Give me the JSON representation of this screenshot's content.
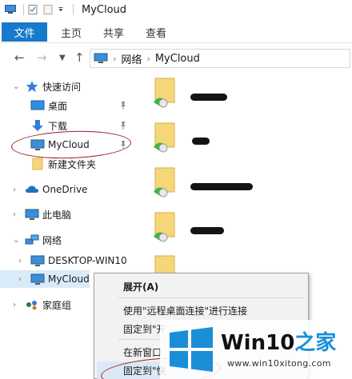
{
  "window": {
    "title": "MyCloud"
  },
  "ribbon": {
    "tabs": [
      {
        "label": "文件"
      },
      {
        "label": "主页"
      },
      {
        "label": "共享"
      },
      {
        "label": "查看"
      }
    ]
  },
  "address": {
    "crumbs": [
      "网络",
      "MyCloud"
    ]
  },
  "nav": {
    "quick_access": "快速访问",
    "desktop": "桌面",
    "downloads": "下载",
    "mycloud_pinned": "MyCloud",
    "new_folder": "新建文件夹",
    "onedrive": "OneDrive",
    "this_pc": "此电脑",
    "network": "网络",
    "desktop_win10": "DESKTOP-WIN10",
    "mycloud_network": "MyCloud",
    "homegroup": "家庭组"
  },
  "context_menu": {
    "items": [
      {
        "label": "展开(A)"
      },
      {
        "label": "使用\"远程桌面连接\"进行连接"
      },
      {
        "label": "固定到\"开"
      },
      {
        "label": "在新窗口"
      },
      {
        "label": "固定到\"快"
      }
    ]
  },
  "watermark": {
    "brand_a": "Win10",
    "brand_b": "之家",
    "url": "www.win10xitong.com"
  },
  "colors": {
    "accent": "#1979ca",
    "selection": "#d9ebf9",
    "annotation": "#9a1f24",
    "logo": "#1a8fd8"
  }
}
